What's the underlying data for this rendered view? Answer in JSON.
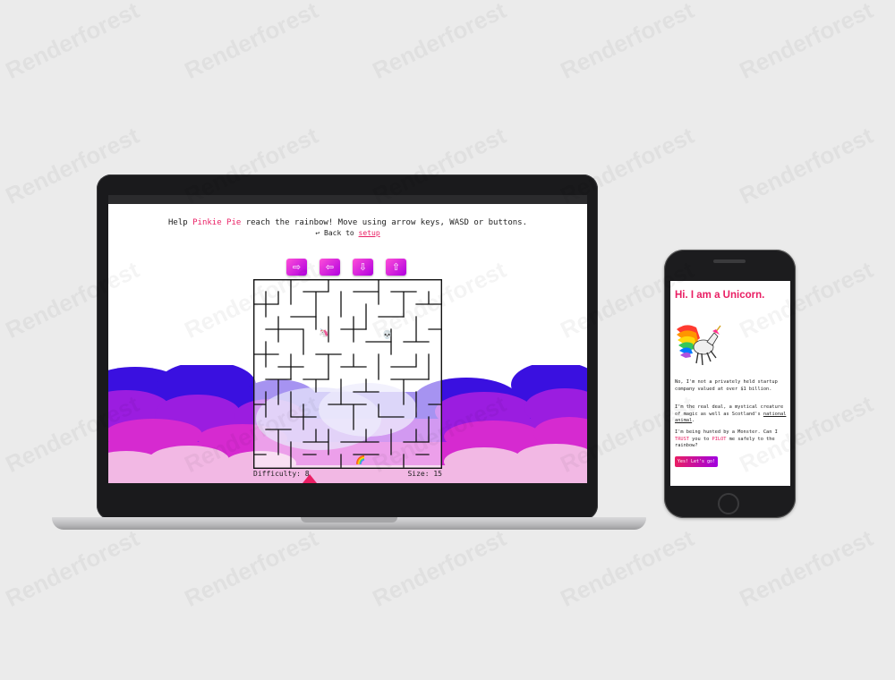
{
  "laptop": {
    "instructions_prefix": "Help",
    "character_name": "Pinkie Pie",
    "instructions_suffix": "reach the rainbow! Move using arrow keys, WASD or buttons.",
    "back_arrow": "↩",
    "back_text": "Back to",
    "setup_link": "setup",
    "controls": [
      {
        "name": "right",
        "glyph": "⇨"
      },
      {
        "name": "left",
        "glyph": "⇦"
      },
      {
        "name": "down",
        "glyph": "⇩"
      },
      {
        "name": "up",
        "glyph": "⇧"
      }
    ],
    "difficulty_label": "Difficulty: 8",
    "size_label": "Size: 15",
    "player_icon": "🦄",
    "monster_icon": "💀",
    "goal_icon": "🌈"
  },
  "phone": {
    "title": "Hi. I am a Unicorn.",
    "para1": "No, I'm not a privately held startup company valued at over $1 billion.",
    "para2_prefix": "I'm the real deal, a mystical creature of magic as well as Scotland's",
    "para2_link": "national animal",
    "para2_suffix": ".",
    "para3_a": "I'm being hunted by a Monster. Can I",
    "para3_trust": "TRUST",
    "para3_b": "you to",
    "para3_pilot": "PILOT",
    "para3_c": "me safely to the rainbow?",
    "button_label": "Yes! Let's go!"
  },
  "colors": {
    "accent": "#e91e63",
    "cloud_blue": "#3a10e0",
    "cloud_purple": "#9b1de0",
    "cloud_magenta": "#d62ad0",
    "cloud_pink": "#f2b8e4"
  },
  "watermark": "Renderforest"
}
